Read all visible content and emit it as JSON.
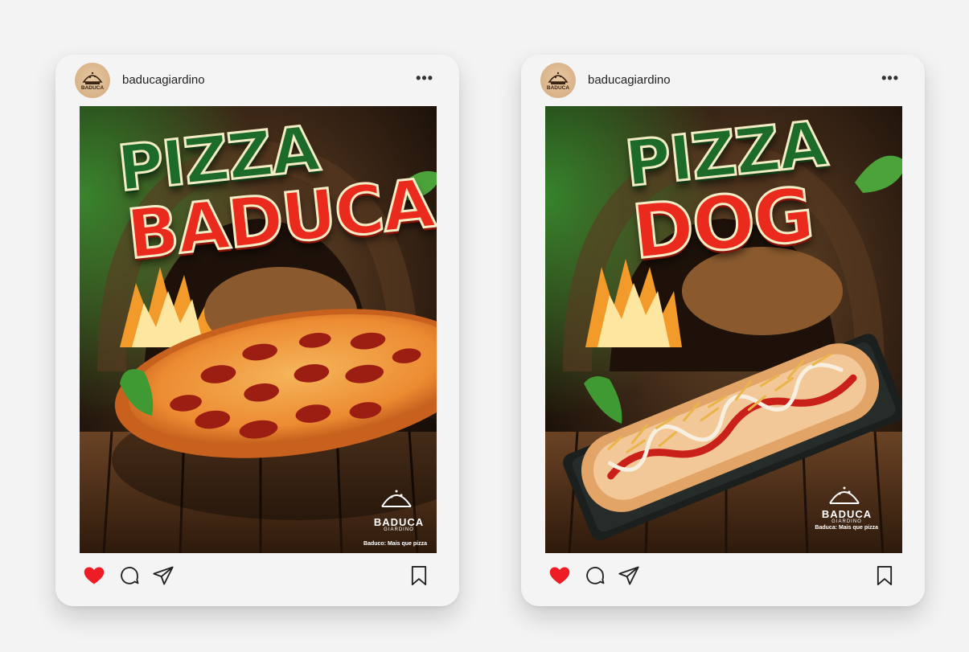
{
  "posts": [
    {
      "username": "baducagiardino",
      "more_label": "•••",
      "title_line1": "PIZZA",
      "title_line2": "BADUCA",
      "brand_name": "BADUCA",
      "brand_sub": "GIARDINO",
      "tagline": "Baduco: Mais que pizza",
      "liked": true
    },
    {
      "username": "baducagiardino",
      "more_label": "•••",
      "title_line1": "PIZZA",
      "title_line2": "DOG",
      "brand_name": "BADUCA",
      "brand_sub": "GIARDINO",
      "tagline": "Baduca: Mais que pizza",
      "liked": true
    }
  ],
  "icons": {
    "like": "heart-icon",
    "comment": "comment-icon",
    "share": "paper-plane-icon",
    "save": "bookmark-icon",
    "more": "more-options-icon"
  },
  "colors": {
    "heart": "#ee1d25",
    "title_green": "#1d6b2a",
    "title_red": "#ea2a1c",
    "card_bg": "#f4f4f4",
    "page_bg": "#f3f3f3"
  }
}
